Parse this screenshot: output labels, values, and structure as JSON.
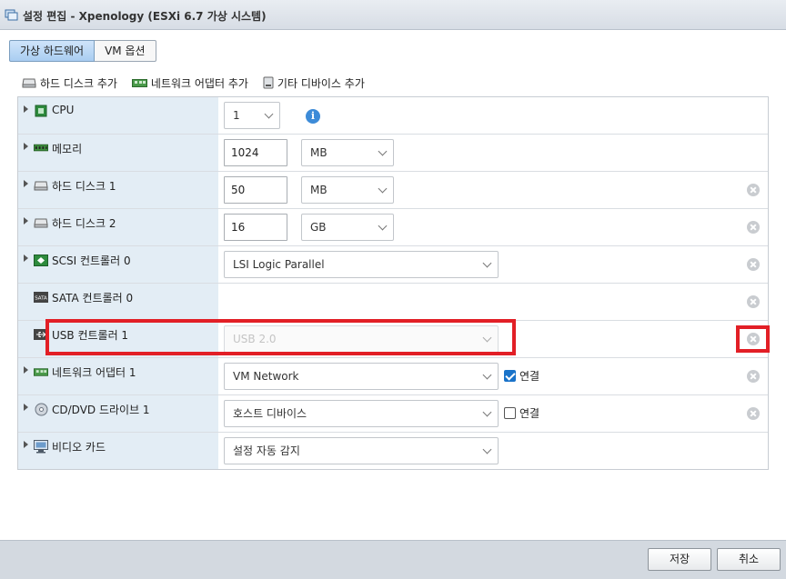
{
  "window": {
    "title": "설정 편집 - Xpenology (ESXi 6.7 가상 시스템)"
  },
  "tabs": [
    {
      "label": "가상 하드웨어",
      "active": true
    },
    {
      "label": "VM 옵션",
      "active": false
    }
  ],
  "toolbar": {
    "add_disk": "하드 디스크 추가",
    "add_network": "네트워크 어댑터 추가",
    "add_other": "기타 디바이스 추가"
  },
  "devices": {
    "cpu": {
      "label": "CPU",
      "value": "1"
    },
    "memory": {
      "label": "메모리",
      "value": "1024",
      "unit": "MB"
    },
    "disk1": {
      "label": "하드 디스크 1",
      "value": "50",
      "unit": "MB"
    },
    "disk2": {
      "label": "하드 디스크 2",
      "value": "16",
      "unit": "GB"
    },
    "scsi": {
      "label": "SCSI 컨트롤러 0",
      "value": "LSI Logic Parallel"
    },
    "sata": {
      "label": "SATA 컨트롤러 0"
    },
    "usb": {
      "label": "USB 컨트롤러 1",
      "value": "USB 2.0"
    },
    "network": {
      "label": "네트워크 어댑터 1",
      "value": "VM Network",
      "connect_label": "연결",
      "connected": true
    },
    "cdrom": {
      "label": "CD/DVD 드라이브 1",
      "value": "호스트 디바이스",
      "connect_label": "연결",
      "connected": false
    },
    "video": {
      "label": "비디오 카드",
      "value": "설정 자동 감지"
    }
  },
  "icons": {
    "sata_badge": "SATA",
    "info": "i"
  },
  "footer": {
    "save_label": "저장",
    "cancel_label": "취소"
  },
  "colors": {
    "highlight": "#e21f26",
    "accent": "#1a73c9"
  }
}
